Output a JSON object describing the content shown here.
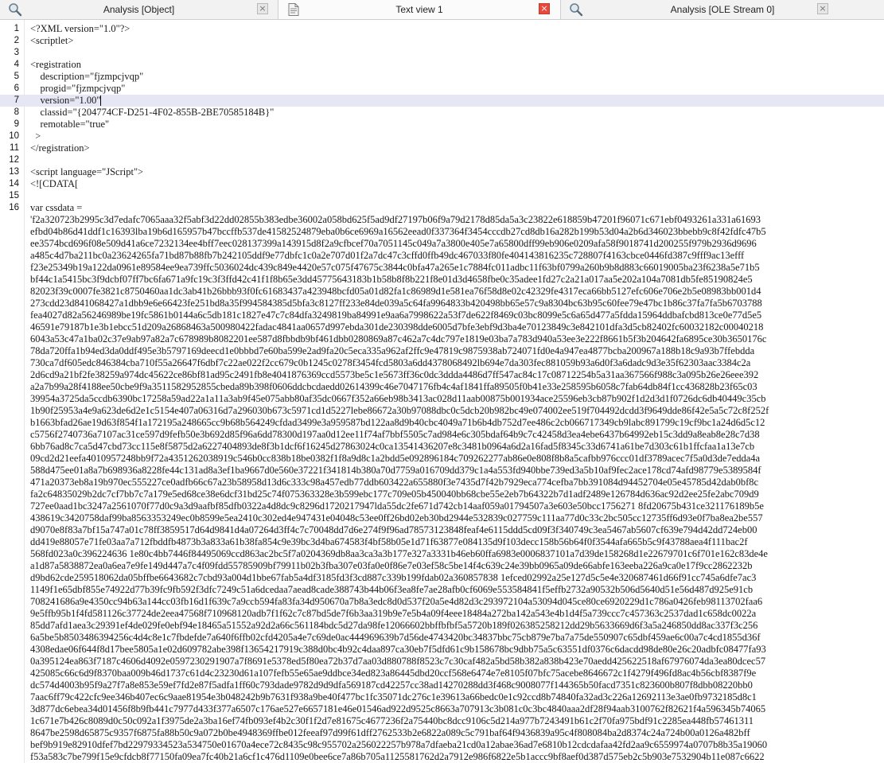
{
  "tabs": [
    {
      "label": "Analysis [Object]",
      "icon": "magnifier-icon",
      "active": false
    },
    {
      "label": "Text view 1",
      "icon": "document-icon",
      "active": true
    },
    {
      "label": "Analysis [OLE Stream 0]",
      "icon": "magnifier-icon",
      "active": false
    }
  ],
  "close_symbol": "×",
  "colors": {
    "active_close": "#e8493b",
    "current_line": "#e6e6f5"
  },
  "editor": {
    "current_line": 7,
    "numbered_lines": [
      {
        "num": "1",
        "text": "<?XML version=\"1.0\"?>"
      },
      {
        "num": "2",
        "text": "<scriptlet>"
      },
      {
        "num": "3",
        "text": ""
      },
      {
        "num": "4",
        "text": "<registration"
      },
      {
        "num": "5",
        "text": "    description=\"fjzmpcjvqp\""
      },
      {
        "num": "6",
        "text": "    progid=\"fjzmpcjvqp\""
      },
      {
        "num": "7",
        "text": "    version=\"1.00\""
      },
      {
        "num": "8",
        "text": "    classid=\"{204774CF-D251-4F02-855B-2BE70585184B}\""
      },
      {
        "num": "9",
        "text": "    remotable=\"true\""
      },
      {
        "num": "10",
        "text": "  >"
      },
      {
        "num": "11",
        "text": "</registration>"
      },
      {
        "num": "12",
        "text": ""
      },
      {
        "num": "13",
        "text": "<script language=\"JScript\">"
      },
      {
        "num": "14",
        "text": "<![CDATA["
      },
      {
        "num": "15",
        "text": ""
      },
      {
        "num": "16",
        "text": "var cssdata ="
      }
    ],
    "data_lines": [
      "'f2a320723b2995c3d7edafc7065aaa32f5abf3d22dd02855b383edbe36002a058bd625f5ad9df27197b06f9a79d2178d85da5a3c23822e618859b47201f96071c671ebf0493261a331a61693",
      "efbd04b86d41ddf1c16393lba19b6d165957b47bccffb537de41582524879eba0b6ce6969a16562eead0f337364f3454cccdb27cd8db16a282b199b53d04a2b6d346023bbebb9c8f42fdfc47b5",
      "ee3574bcd696f08e509d41a6ce7232134ee4bff7eec028137399a143915d8f2a9cfbcef70a7051145c049a7a3800e405e7a65800dff99eb906e0209afa58f9018741d200255f979b2936d9696",
      "a485c4d7ba211bc0a23624265fa71bd87b88fb7b242105ddf9e77dbfc1c0a2e707d01f2a7dc47c3cffd0ffb49dc467033f80fe404143816235c728807f4163cbce0446fd387c9fff9ac13efff",
      "f23e25349b19a122da0961e89584ee9ea739ffc5036024dc439c849e4420e57c075f47675c3844c0bfa47a265e1c7884fc011adbc11f63bf0799a260b9b8d883c66019005ba23f6238a5e71b5",
      "bf44c1a5415bc3f9dcbf07ff7bc6fa671a9fc19c3f3ffd42c41f1f8b65e3dd45775643183b1b58b8f8b221f8e01d3d4658fbe0c35adee1fd27c2a21a017aa5e202a104a7081db5fe85190824e5",
      "82023f39c0007fe3821c8750460aa1dc3ab41b26bbb93f0fc61683437a423948bcfd05a01d82fa1c86989d1e581ea76f58d8e02c42329fe4317eca66bb5127efc606e706e2b5e08983bb001d4",
      "273cdd23d841068427a1dbb9e6e66423fe251bd8a35f994584385d5bfa3c8127ff233e84de039a5c64fa9964833b420498bb65e57c9a8304bc63b95c60fee79e47bc1b86c37fa7fa5b6703788",
      "fea4027d82a56246989be19fc5861b0144a6c5db181c1827e47c7c84dfa3249819ba84991e9aa6a7998622a53f7de622f8469c03bc8099e5c6a65d477a5fdda15964ddbafcbd813ce0e77d5e5",
      "46591e79187b1e3b1ebcc51d209a26868463a500980422fadac4841aa0657d997ebda301de230398dde6005d7bfe3ebf9d3ba4e70123849c3e842101dfa3d5cb82402fc60032182c00040218",
      "6043a53c47a1ba02c37e9ab97a82a7c678989b8082201ee587d8fbbdb9bf461dbb0280869a87c462a7c4dc797e1819e03ba7a783d940a53ee3e222f8661b5f3b204642fa6895ce30b3650176c",
      "78da720ffa1b94ed3da0ddf495e3b5797169deecd1e0bbbd7e60ba599e2ad9fa20c5eca335a962af2ffc9e47819c9875938ab724071fd0e4a947ea4877bcba200967a188b18c9a93b7ffebdda",
      "730ca7df605edc846384cba710f55a26647f6dbf7c22ae022f2cc679c0b1245c0278f3454fcd5803a6dd4378068492lb694e7da303fec881059b93a6d0f3a6dadc9d3e35f62303aac3384c2a",
      "2d6cd9a21bf2fe38259a974dc45622ce86bf81ad95c2491fb8e4041876369ccd5573be5c1e5673ff36c0dc3ddda4486d7ff547ac84c17c08712254b5a31aa367566f988c3a095b26e26eee392",
      "a2a7b99a28f4188ee50cbe9f9a3511582952855cbeda89b398f0606ddcbcdaedd02614399c46e7047176fb4c4af1841ffa89505f0b41e33e258595b6058c7fab64db84f1cc436828b23f65c03",
      "39954a3725da5ccdb6390bc17258a59ad22a1a11a3ab9f45e075abb80af35dc0667f352a66eb98b3413ac028d11aab00875b001934ace25596eb3cb87b902f1d2d3d1f0726dc6db40449c35cb",
      "1b90f25953a4e9a623de6d2e1c5154e407a06316d7a296030b673c5971cd1d5227lebe86672a30b97088dbc0c5dcb20b982bc49e074002ee519f704492dcdd3f9649dde86f42e5a5c72c8f252f",
      "b1663bfad26ae19d63f854f1a172195a248665cc9b68b564249cfdad3499e3a959587bd122aa8d9b40cbc4049a71b6b4db752d7ee486c2cb066717349cb9labc891799c19cf9bc1a24d6d5c12",
      "c5756f2740736a7107ac31ce597d9fefb50e3b692d85f96a6dd78300d197aa0d12ee11f74af7bbf5505c7ad984e6c305bdaf64b9c7c42458d3ea4ebe6437b64992eb15c3dd9a8eab8e28c7d38",
      "6bb76ad8c7ca5d47cbd73cc115e8f5875d2a6227404893de8f3b1dcf6f16245d27863024c0ca13541436207e8c3481b0964a6d2a16fad5f8345c33d6741a61be7d303c61b1ffcfaa1a13e7cb",
      "09cd2d21eefa4010957248bb9f72a4351262038919c546b0cc838b18be0382f1f8a9d8c1a2bdd5e092896184c709262277ab86e0e808f8b8a5cafbb976ccc01df3789acec7f5a0d3de7edda4a",
      "588d475ee01a8a7b698936a8228fe44c131ad8a3ef1ba9667d0e560e37221f341814b380a70d7759a016709dd379c1a4a553fd940bbe739ed3a5b10af9fec2ace178cd74afd98779e5389584f",
      "471a20373eb8a19b970ec555227ce0adfb66c67a23b58958d13d6c333c98a457edb77ddb603422a655880f3e7435d7f42b7929eca774cefba7bb391084d94452704e05e45785d42dab0bf8c",
      "fa2c64835029b2dc7cf7bb7c7a179e5ed68ce38e6dcf31bd25c74f075363328e3b599ebc177c709e05b450040bb68cbe55e2eb7b64322b7d1adf2489e126784d636ac92d2ee25fe2abc709d9",
      "727ee0aad1bc3247a2561070f77d0c9a3d9aafbf85dfb0322a4d8dc9c8296d1720217947lda55dc2fe671d742cb14aaf059a01794507a3e603e50bcc1756271 8fd20675b431ce321176189b5e",
      "438619c3420758daf99ba8563353249ec0b8599e5ea2410c302ed4e947431e04048c53ee0ff26bd02eb30bd2944e532839c027759c111aa77d0c33c2bc505cc12735ff6d93e0f7ba8ea2be557",
      "d9070e8f83a7bf15a747a01c78ff3859517d64d9841d4a07264d3ff4c7c70048dd7d6e274f9f96ad78573123848feaf4e6115ddd5cd09f3f340749c3ea5467ab5607cf639e794d42dd724eb00",
      "dd419e88057e71fe03aa7a712fbddfb4873b3a833a61b38fa854c9e39bc3d4ba674583f4bf58b05e1d71f63877e084135d9f103decc158b56b64f0f3544afa665b5c9f43788aea4f111bac2f",
      "568fd023a0c396224636 1e80c4bb7446f84495069ccd863ac2bc5f7a0204369db8aa3ca3a3b177e327a3331b46eb60ffa6983e0006837101a7d39de158268d1e22679701c6f701e162c83de4e",
      "a1d87a5838872ea0a6ea7e9fe149d447a7c4f09fdd55785909bf79911b02b3fba307e03fa0e0f86e7e03ef58c5be14f4c639c24e39bb0965a09de66abfe163eeba226a9ca0e17f9cc2862232b",
      "d9bd62cde259518062da05bffbe6643682c7cbd93a004d1bbe67fab5a4df3185fd3f3cd887c339b199fdab02a360857838 1efced02992a25e127d5c5e4e320687461d66f91cc745a6dfe7ac3",
      "1149f1e65dbf855e74922d77b39fc9fb592f3dfc7249c51a6dcedaa7aead8cade388743b44b06f3ea8fe7ae28afb0cf6069e553584841f5effb2732a90532b506d5640d51e56d487d925e91cb",
      "708241686a9e4350cc94b63a144cc03fb16d1f639c7a9ccb594fa83fa34d950670a7b8a3edc8d0d537f20a5e4d82d3c293972104a53094d045ce80ce6920229d1c786a0426feb98113702faa6",
      "9e5ffb95b1f4fd581126c37724de2eea47568f710968120adb7f1f62c7c87bd5de7f6b3aa319b9e7e5b4a09f4eee18484a272ba142a543e4b1d4f5a739ccc7c457363c2537dad1c658dc0022a",
      "85dd7afd1aea3c29391ef4de029fe0ebf94e18465a51552a92d2a66c561184bdc5d27da98fe12066602bbffbfbf5a5720b189f026385258212dd29b5633669d6f3a5a246850dd8ac337f3c256",
      "6a5be5b8503486394256c4d4c8e1c7fbdefde7a640f6ffb02cfd4205a4e7c69de0ac444969639b7d56de4743420bc34837bbc75cb879e7ba7a75de550907c65dbf459ae6c00a7c4cd1855d36f",
      "4308edae06f644f8d17bee5805a1e02d609782abe398f13654217919c388d0bc4b92c4daa897ca30eb7f5dfd61c9b158678bc9dbb75a5c63551df0376c6dacdd98de80e26c20adbfc08477fa93",
      "0a395124ea863f7187c4606d4092e0597230291907a7f8691e5378ed5f80ea72b37d7aa03d880788f8523c7c30caf482a5bd58b382a838b423e70aedd425622518af67976074da3ea80dcec57",
      "425085c66c6d9f8370baa009b46d1737c61d4c23230d61a107fefb55e65ae9ddbce34ed823a86445dbd20ccf568e6474e7e8105f07bfc75acebe8646672c1f4279f496fd8ac4b56cbf8387f9e",
      "dc574d4003b95f9a27f7a8e853e59ef7fd2e87f5adfa1ff60c793dade9782d9d9dfa569187cd42257cc38ad14270288dd3f468c9008077f144365b50facd7351c823600b807f8dbb08220bb0",
      "7aac6ff79c422cfc9ee346b407ec6c9aae81954e3b048242b9b7631f938a9be40f477bc1fc35071dc276c1e39613a66bedc0e1c92ccd8b74840fa32ad3c226a12692113e3ae0fb9732185d8c1",
      "3d877dc6ebea34d01456f8b9fb441c7977d433f377a6507c176ae527e6657181e46e01546ad922d9525c8663a707913c3b081c0c3bc4840aaa2df28f94aab3100762f82621f4a596345b74065",
      "1c671e7b426c8089d0c50c092a1f3975de2a3ba16ef74fb093ef4b2c30f1f2d7e81675c4677236f2a75440bc8dcc9106c5d214a977b7243491b61c2f70fa975bdf91c2285ea448fb57461311",
      "8647be2598d65875c9357f6875fa88b50c9a072b0be4948369ffbe012feeaf97d99f61dff2762533b2e6822a089c5c791baf64f9436839a95c4f808084ba2d8374c24a724b00a0126a482bff",
      "bef9b919e82910dfef7bd22979334523a534750e01670a4ece72c8435c98c955702a256022257b978a7dfaeba21cd0a12abae36ad7e6810b12cdcdafaa42fd2aa9c6559974a0707b8b35a19060",
      "f53a583c7be799f15e9cfdcb8f77150fa09ea7fc40b21a6cf1c476d1109e0bee6ce7a86b705a1125581762d2a7912e986f6822e5b1accc9bf8aef0d387d575eb2c5b903e7532904b11e087c6622"
    ]
  }
}
